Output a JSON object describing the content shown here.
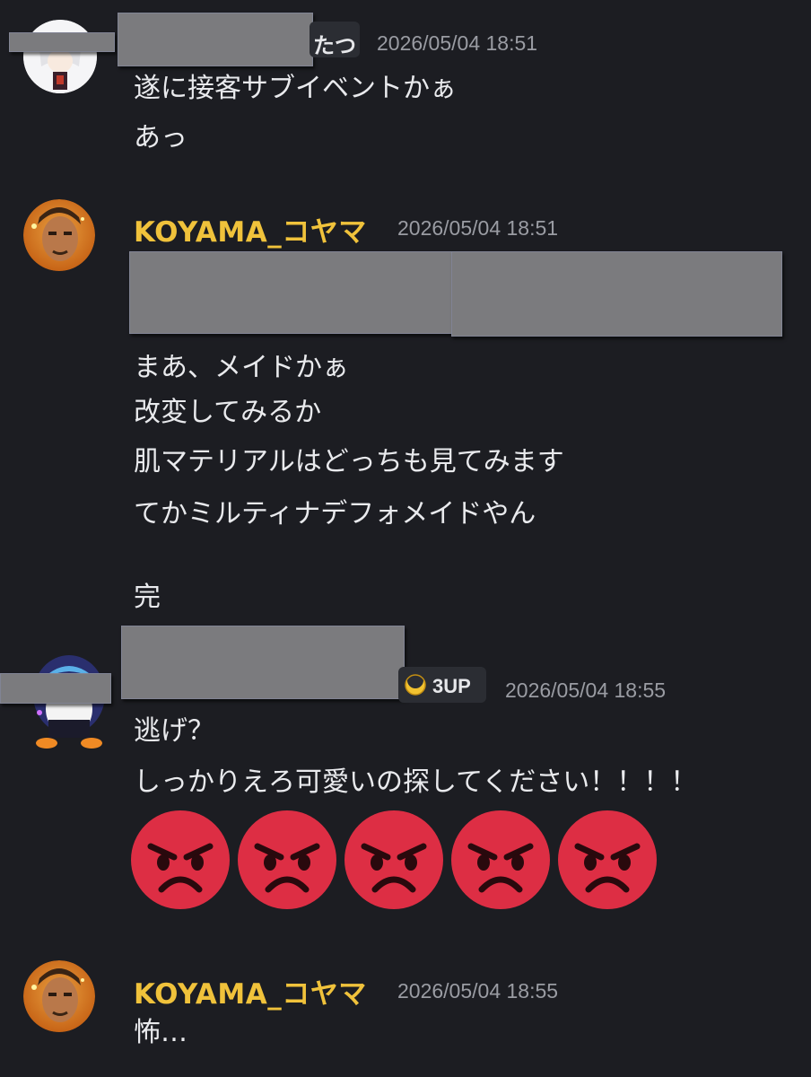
{
  "messages": [
    {
      "author_suffix": "たつ",
      "timestamp": "2026/05/04 18:51",
      "lines": [
        "遂に接客サブイベントかぁ",
        "あっ"
      ]
    },
    {
      "author": "KOYAMA_コヤマ",
      "timestamp": "2026/05/04 18:51",
      "lines": [
        "まあ、メイドかぁ",
        "改変してみるか",
        "肌マテリアルはどっちも見てみます",
        "てかミルティナデフォメイドやん",
        "完"
      ]
    },
    {
      "badge": "3UP",
      "timestamp": "2026/05/04 18:55",
      "lines": [
        "逃げ？",
        "しっかりえろ可愛いの探してください！！！！"
      ],
      "emoji_reactions": [
        "pouting-face",
        "pouting-face",
        "pouting-face",
        "pouting-face",
        "pouting-face"
      ]
    },
    {
      "author": "KOYAMA_コヤマ",
      "timestamp": "2026/05/04 18:55",
      "lines": [
        "怖…"
      ]
    }
  ],
  "colors": {
    "background": "#1c1d22",
    "koyama_name": "#f0c23b",
    "timestamp": "#9a9ca3",
    "redaction": "#7b7b7e",
    "emoji_red": "#dd2e44"
  }
}
